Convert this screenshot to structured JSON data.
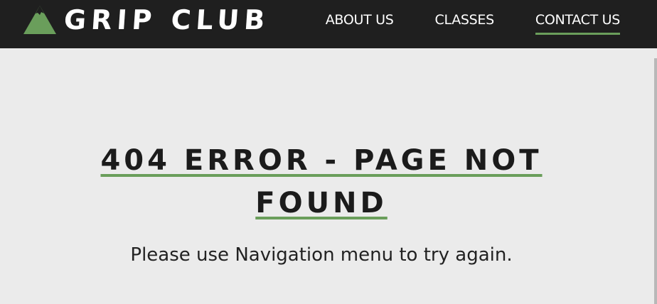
{
  "brand": {
    "name": "GRIP CLUB",
    "logo_icon": "mountain-icon",
    "logo_color": "#6a9e5b"
  },
  "nav": {
    "items": [
      {
        "label": "ABOUT US",
        "active": false
      },
      {
        "label": "CLASSES",
        "active": false
      },
      {
        "label": "CONTACT US",
        "active": true
      }
    ]
  },
  "main": {
    "title": "404 ERROR - PAGE NOT FOUND",
    "message": "Please use Navigation menu to try again."
  },
  "colors": {
    "header_bg": "#1f1f1f",
    "page_bg": "#ebebeb",
    "accent": "#6a9e5b",
    "text": "#1b1b1b"
  }
}
